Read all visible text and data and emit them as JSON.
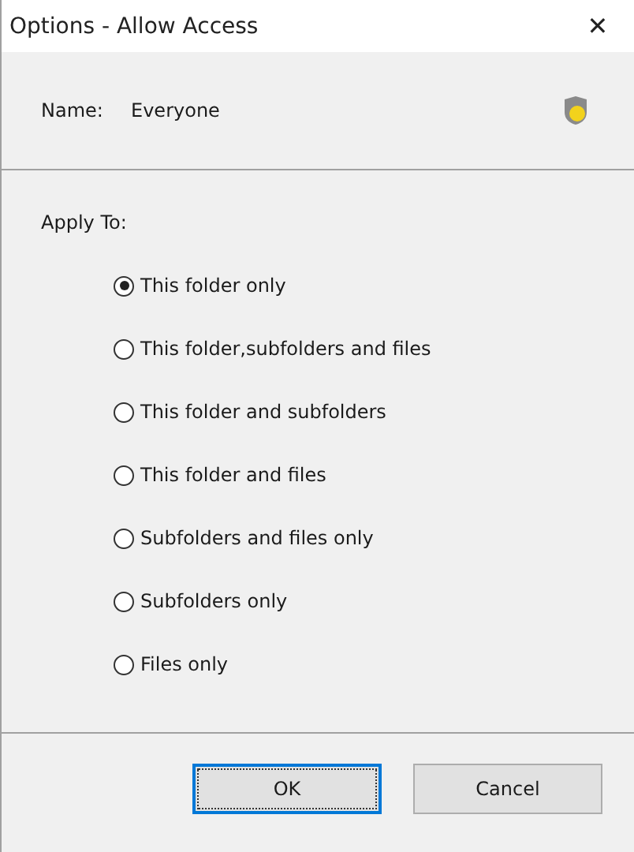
{
  "window": {
    "title": "Options - Allow Access",
    "close": "✕"
  },
  "name_row": {
    "label": "Name:",
    "value": "Everyone"
  },
  "apply_to": {
    "label": "Apply To:",
    "options": [
      {
        "label": "This folder only",
        "selected": true
      },
      {
        "label": "This folder,subfolders and files",
        "selected": false
      },
      {
        "label": "This folder and subfolders",
        "selected": false
      },
      {
        "label": "This folder and files",
        "selected": false
      },
      {
        "label": "Subfolders and files only",
        "selected": false
      },
      {
        "label": "Subfolders only",
        "selected": false
      },
      {
        "label": "Files only",
        "selected": false
      }
    ]
  },
  "buttons": [
    {
      "label": "OK",
      "focused": true
    },
    {
      "label": "Cancel",
      "focused": false
    }
  ]
}
